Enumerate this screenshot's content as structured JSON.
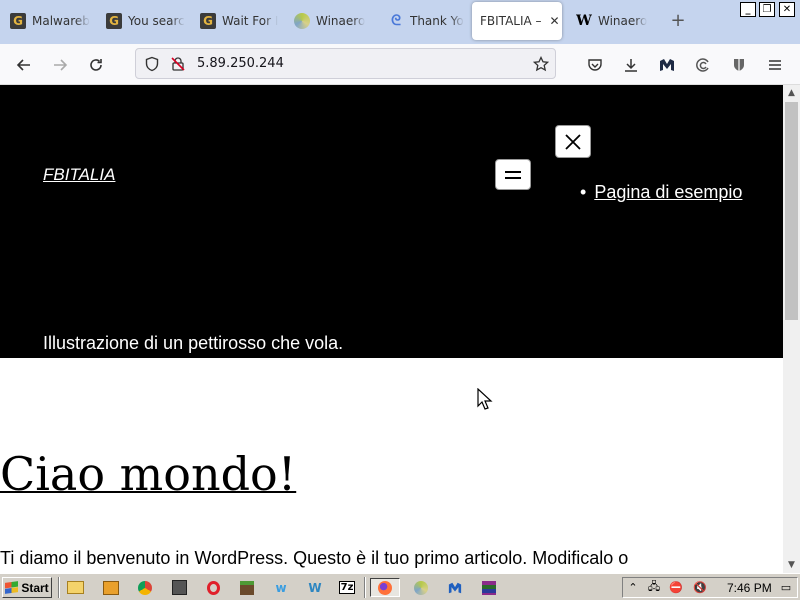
{
  "browser": {
    "tabs": [
      {
        "label": "Malwareb",
        "favicon": "g-icon",
        "active": false
      },
      {
        "label": "You searc",
        "favicon": "g-icon",
        "active": false
      },
      {
        "label": "Wait For I",
        "favicon": "g-icon",
        "active": false
      },
      {
        "label": "Winaero",
        "favicon": "swirl-icon",
        "active": false
      },
      {
        "label": "Thank Yo",
        "favicon": "spiral-icon",
        "active": false
      },
      {
        "label": "FBITALIA –",
        "favicon": "none",
        "active": true
      },
      {
        "label": "Winaero",
        "favicon": "w-icon",
        "active": false
      }
    ],
    "new_tab": "+",
    "url": "5.89.250.244"
  },
  "page": {
    "site_title": "FBITALIA",
    "menu_items": [
      {
        "label": "Pagina di esempio"
      }
    ],
    "hero_caption": "Illustrazione di un pettirosso che vola.",
    "post_title": "Ciao mondo!",
    "post_excerpt": "Ti diamo il benvenuto in WordPress. Questo è il tuo primo articolo. Modificalo o"
  },
  "taskbar": {
    "start_label": "Start",
    "clock": "7:46 PM"
  },
  "colors": {
    "hero_bg": "#000000",
    "tabbar_bg": "#c5d4ee",
    "taskbar_bg": "#d4d0c8"
  }
}
